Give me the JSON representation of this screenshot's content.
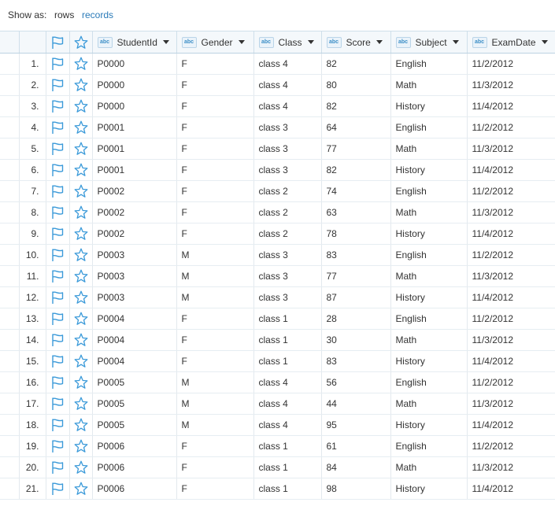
{
  "view_toggle": {
    "label": "Show as:",
    "options": [
      "rows",
      "records"
    ],
    "active": "rows"
  },
  "columns": {
    "student_id": "StudentId",
    "gender": "Gender",
    "class": "Class",
    "score": "Score",
    "subject": "Subject",
    "exam_date": "ExamDate"
  },
  "type_badge": "abc",
  "icons": {
    "flag": "flag-icon",
    "star": "star-icon"
  },
  "colors": {
    "accent": "#2a7ab8",
    "icon": "#3b9ad9",
    "header_bg": "#f4f8fb"
  },
  "rows": [
    {
      "n": "1.",
      "student_id": "P0000",
      "gender": "F",
      "class": "class 4",
      "score": "82",
      "subject": "English",
      "exam_date": "11/2/2012"
    },
    {
      "n": "2.",
      "student_id": "P0000",
      "gender": "F",
      "class": "class 4",
      "score": "80",
      "subject": "Math",
      "exam_date": "11/3/2012"
    },
    {
      "n": "3.",
      "student_id": "P0000",
      "gender": "F",
      "class": "class 4",
      "score": "82",
      "subject": "History",
      "exam_date": "11/4/2012"
    },
    {
      "n": "4.",
      "student_id": "P0001",
      "gender": "F",
      "class": "class 3",
      "score": "64",
      "subject": "English",
      "exam_date": "11/2/2012"
    },
    {
      "n": "5.",
      "student_id": "P0001",
      "gender": "F",
      "class": "class 3",
      "score": "77",
      "subject": "Math",
      "exam_date": "11/3/2012"
    },
    {
      "n": "6.",
      "student_id": "P0001",
      "gender": "F",
      "class": "class 3",
      "score": "82",
      "subject": "History",
      "exam_date": "11/4/2012"
    },
    {
      "n": "7.",
      "student_id": "P0002",
      "gender": "F",
      "class": "class 2",
      "score": "74",
      "subject": "English",
      "exam_date": "11/2/2012"
    },
    {
      "n": "8.",
      "student_id": "P0002",
      "gender": "F",
      "class": "class 2",
      "score": "63",
      "subject": "Math",
      "exam_date": "11/3/2012"
    },
    {
      "n": "9.",
      "student_id": "P0002",
      "gender": "F",
      "class": "class 2",
      "score": "78",
      "subject": "History",
      "exam_date": "11/4/2012"
    },
    {
      "n": "10.",
      "student_id": "P0003",
      "gender": "M",
      "class": "class 3",
      "score": "83",
      "subject": "English",
      "exam_date": "11/2/2012"
    },
    {
      "n": "11.",
      "student_id": "P0003",
      "gender": "M",
      "class": "class 3",
      "score": "77",
      "subject": "Math",
      "exam_date": "11/3/2012"
    },
    {
      "n": "12.",
      "student_id": "P0003",
      "gender": "M",
      "class": "class 3",
      "score": "87",
      "subject": "History",
      "exam_date": "11/4/2012"
    },
    {
      "n": "13.",
      "student_id": "P0004",
      "gender": "F",
      "class": "class 1",
      "score": "28",
      "subject": "English",
      "exam_date": "11/2/2012"
    },
    {
      "n": "14.",
      "student_id": "P0004",
      "gender": "F",
      "class": "class 1",
      "score": "30",
      "subject": "Math",
      "exam_date": "11/3/2012"
    },
    {
      "n": "15.",
      "student_id": "P0004",
      "gender": "F",
      "class": "class 1",
      "score": "83",
      "subject": "History",
      "exam_date": "11/4/2012"
    },
    {
      "n": "16.",
      "student_id": "P0005",
      "gender": "M",
      "class": "class 4",
      "score": "56",
      "subject": "English",
      "exam_date": "11/2/2012"
    },
    {
      "n": "17.",
      "student_id": "P0005",
      "gender": "M",
      "class": "class 4",
      "score": "44",
      "subject": "Math",
      "exam_date": "11/3/2012"
    },
    {
      "n": "18.",
      "student_id": "P0005",
      "gender": "M",
      "class": "class 4",
      "score": "95",
      "subject": "History",
      "exam_date": "11/4/2012"
    },
    {
      "n": "19.",
      "student_id": "P0006",
      "gender": "F",
      "class": "class 1",
      "score": "61",
      "subject": "English",
      "exam_date": "11/2/2012"
    },
    {
      "n": "20.",
      "student_id": "P0006",
      "gender": "F",
      "class": "class 1",
      "score": "84",
      "subject": "Math",
      "exam_date": "11/3/2012"
    },
    {
      "n": "21.",
      "student_id": "P0006",
      "gender": "F",
      "class": "class 1",
      "score": "98",
      "subject": "History",
      "exam_date": "11/4/2012"
    }
  ]
}
